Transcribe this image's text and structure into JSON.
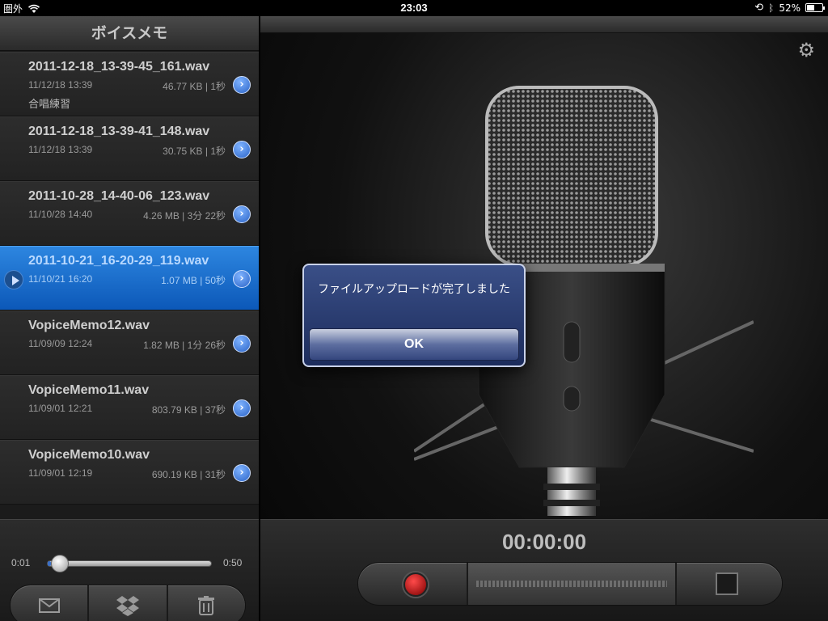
{
  "status_bar": {
    "carrier": "圏外",
    "time": "23:03",
    "battery_percent": "52%",
    "battery_level": 0.52
  },
  "list_header": {
    "title": "ボイスメモ"
  },
  "recordings": [
    {
      "name": "2011-12-18_13-39-45_161.wav",
      "date": "11/12/18 13:39",
      "meta": "46.77 KB | 1秒",
      "memo": "合唱練習",
      "selected": false
    },
    {
      "name": "2011-12-18_13-39-41_148.wav",
      "date": "11/12/18 13:39",
      "meta": "30.75 KB | 1秒",
      "memo": "",
      "selected": false
    },
    {
      "name": "2011-10-28_14-40-06_123.wav",
      "date": "11/10/28 14:40",
      "meta": "4.26 MB | 3分 22秒",
      "memo": "",
      "selected": false
    },
    {
      "name": "2011-10-21_16-20-29_119.wav",
      "date": "11/10/21 16:20",
      "meta": "1.07 MB | 50秒",
      "memo": "",
      "selected": true
    },
    {
      "name": "VopiceMemo12.wav",
      "date": "11/09/09 12:24",
      "meta": "1.82 MB | 1分 26秒",
      "memo": "",
      "selected": false
    },
    {
      "name": "VopiceMemo11.wav",
      "date": "11/09/01 12:21",
      "meta": "803.79 KB | 37秒",
      "memo": "",
      "selected": false
    },
    {
      "name": "VopiceMemo10.wav",
      "date": "11/09/01 12:19",
      "meta": "690.19 KB | 31秒",
      "memo": "",
      "selected": false
    }
  ],
  "player": {
    "time_start": "0:01",
    "time_end": "0:50",
    "progress": 0.02
  },
  "recorder": {
    "timer": "00:00:00"
  },
  "alert": {
    "message": "ファイルアップロードが完了しました",
    "ok_label": "OK"
  },
  "colors": {
    "selected_row": "#1a6fd0",
    "record_red": "#c00000"
  }
}
